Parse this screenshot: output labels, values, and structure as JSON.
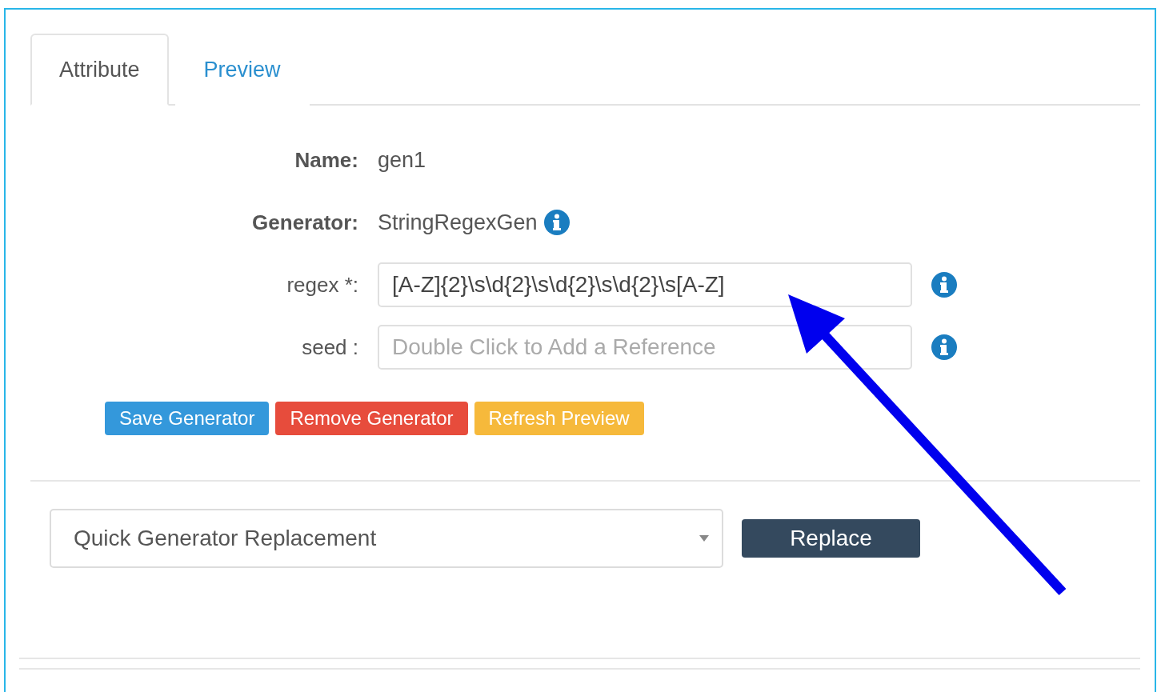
{
  "tabs": [
    {
      "label": "Attribute",
      "selected": true
    },
    {
      "label": "Preview",
      "selected": false
    }
  ],
  "fields": [
    {
      "kind": "static",
      "label": "Name:",
      "value": "gen1"
    },
    {
      "kind": "static",
      "label": "Generator:",
      "value": "StringRegexGen",
      "info": true
    },
    {
      "kind": "input",
      "label": "regex *:",
      "value": "[A-Z]{2}\\s\\d{2}\\s\\d{2}\\s\\d{2}\\s[A-Z]",
      "info": true
    },
    {
      "kind": "input",
      "label": "seed :",
      "placeholder": "Double Click to Add a Reference",
      "info": true
    }
  ],
  "buttons": [
    {
      "label": "Save Generator",
      "kind": "primary"
    },
    {
      "label": "Remove Generator",
      "kind": "danger"
    },
    {
      "label": "Refresh Preview",
      "kind": "warning"
    }
  ],
  "replacement": {
    "value": "Quick Generator Replacement",
    "button": "Replace"
  }
}
